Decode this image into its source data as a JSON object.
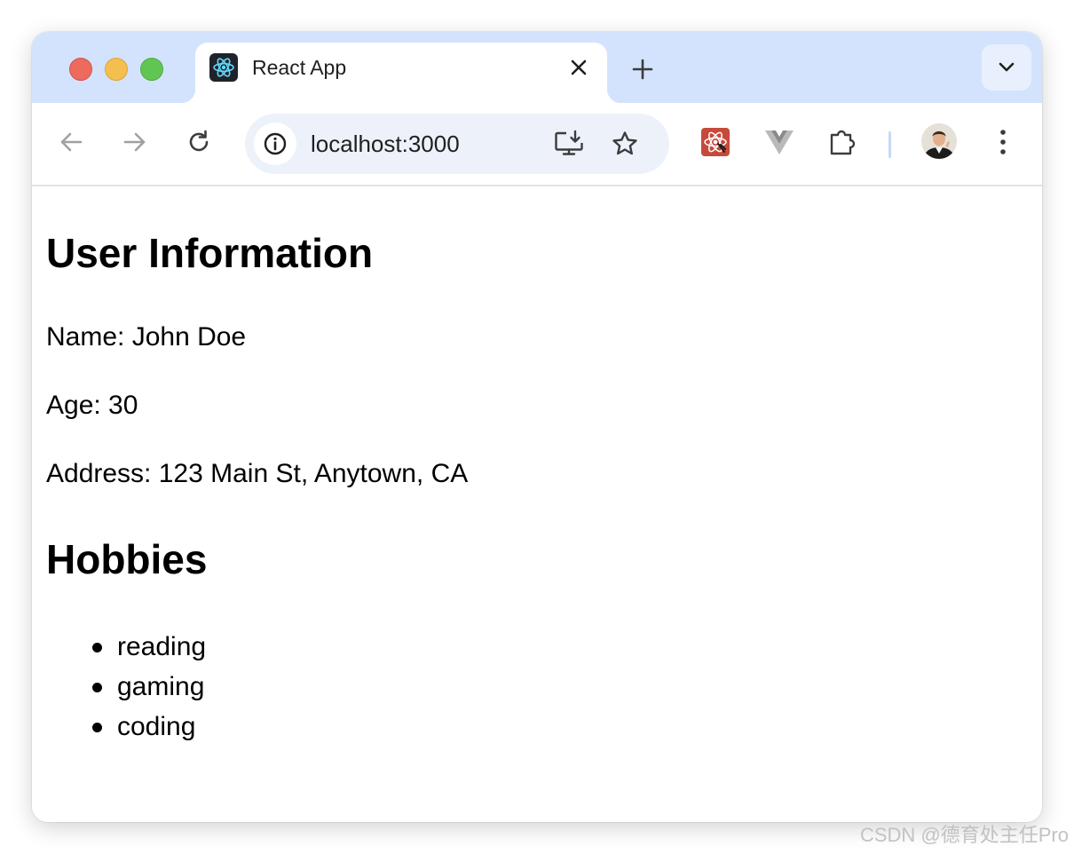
{
  "browser": {
    "tab": {
      "title": "React App",
      "favicon": "react-icon"
    },
    "address_bar": {
      "url": "localhost:3000"
    },
    "icons": {
      "back": "arrow-left-icon",
      "forward": "arrow-right-icon",
      "reload": "reload-icon",
      "site_info": "info-icon",
      "install": "install-app-icon",
      "bookmark": "star-icon",
      "react_devtools": "react-devtools-icon",
      "vue_devtools": "vue-devtools-icon",
      "extensions": "puzzle-icon",
      "menu": "kebab-menu-icon",
      "new_tab": "plus-icon",
      "tab_search": "chevron-down-icon",
      "close_tab": "close-icon"
    },
    "colors": {
      "tabstrip": "#d3e3fd",
      "omnibox": "#edf2fa",
      "close": "#ed6a5e",
      "minimize": "#f4bf4f",
      "maximize": "#61c554"
    }
  },
  "page": {
    "heading": "User Information",
    "name": "Name: John Doe",
    "age": "Age: 30",
    "address": "Address: 123 Main St, Anytown, CA",
    "hobbies_heading": "Hobbies",
    "hobbies": [
      "reading",
      "gaming",
      "coding"
    ]
  },
  "watermark": "CSDN @德育处主任Pro"
}
